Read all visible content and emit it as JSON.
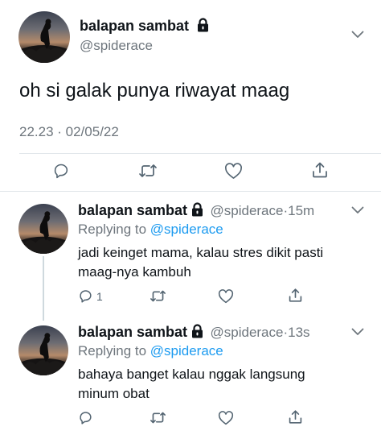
{
  "main_tweet": {
    "name": "balapan sambat",
    "handle": "@spiderace",
    "text": "oh si galak punya riwayat maag",
    "timestamp": "22.23 · 02/05/22",
    "actions": [
      "reply-icon",
      "retweet-icon",
      "like-icon",
      "share-icon"
    ]
  },
  "replies": [
    {
      "name": "balapan sambat",
      "handle": "@spiderace",
      "time": "15m",
      "replying_prefix": "Replying to ",
      "replying_handle": "@spiderace",
      "line1": "jadi keinget mama, kalau stres dikit pasti",
      "line2": "maag-nya kambuh",
      "reply_count": "1"
    },
    {
      "name": "balapan sambat",
      "handle": "@spiderace",
      "time": "13s",
      "replying_prefix": "Replying to ",
      "replying_handle": "@spiderace",
      "line1": "bahaya banget kalau nggak langsung",
      "line2": "minum obat",
      "reply_count": ""
    }
  ],
  "colors": {
    "text": "#0f1419",
    "secondary": "#6e767d",
    "link": "#1d9bf0",
    "divider": "#e1e6ea"
  }
}
